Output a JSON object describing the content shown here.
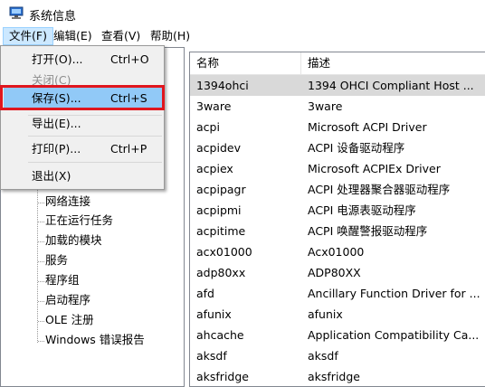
{
  "window": {
    "title": "系统信息",
    "icon": "system-info-icon"
  },
  "menubar": [
    {
      "label": "文件(F)"
    },
    {
      "label": "编辑(E)"
    },
    {
      "label": "查看(V)"
    },
    {
      "label": "帮助(H)"
    }
  ],
  "file_menu": {
    "items": [
      {
        "label": "打开(O)...",
        "shortcut": "Ctrl+O"
      },
      {
        "label": "关闭(C)",
        "shortcut": ""
      },
      {
        "label": "保存(S)...",
        "shortcut": "Ctrl+S"
      },
      {
        "label": "导出(E)...",
        "shortcut": ""
      },
      {
        "label": "打印(P)...",
        "shortcut": "Ctrl+P"
      },
      {
        "label": "退出(X)",
        "shortcut": ""
      }
    ]
  },
  "tree": {
    "items": [
      {
        "label": "网络连接"
      },
      {
        "label": "正在运行任务"
      },
      {
        "label": "加载的模块"
      },
      {
        "label": "服务"
      },
      {
        "label": "程序组"
      },
      {
        "label": "启动程序"
      },
      {
        "label": "OLE 注册"
      },
      {
        "label": "Windows 错误报告"
      }
    ]
  },
  "table": {
    "columns": [
      "名称",
      "描述"
    ],
    "rows": [
      {
        "name": "1394ohci",
        "desc": "1394 OHCI Compliant Host ..."
      },
      {
        "name": "3ware",
        "desc": "3ware"
      },
      {
        "name": "acpi",
        "desc": "Microsoft ACPI Driver"
      },
      {
        "name": "acpidev",
        "desc": "ACPI 设备驱动程序"
      },
      {
        "name": "acpiex",
        "desc": "Microsoft ACPIEx Driver"
      },
      {
        "name": "acpipagr",
        "desc": "ACPI 处理器聚合器驱动程序"
      },
      {
        "name": "acpipmi",
        "desc": "ACPI 电源表驱动程序"
      },
      {
        "name": "acpitime",
        "desc": "ACPI 唤醒警报驱动程序"
      },
      {
        "name": "acx01000",
        "desc": "Acx01000"
      },
      {
        "name": "adp80xx",
        "desc": "ADP80XX"
      },
      {
        "name": "afd",
        "desc": "Ancillary Function Driver for ..."
      },
      {
        "name": "afunix",
        "desc": "afunix"
      },
      {
        "name": "ahcache",
        "desc": "Application Compatibility Ca..."
      },
      {
        "name": "aksdf",
        "desc": "aksdf"
      },
      {
        "name": "aksfridge",
        "desc": "aksfridge"
      }
    ]
  },
  "colors": {
    "highlight_border": "#e0161e",
    "hover": "#91c9f7",
    "selected_row": "#d9d9d9"
  }
}
